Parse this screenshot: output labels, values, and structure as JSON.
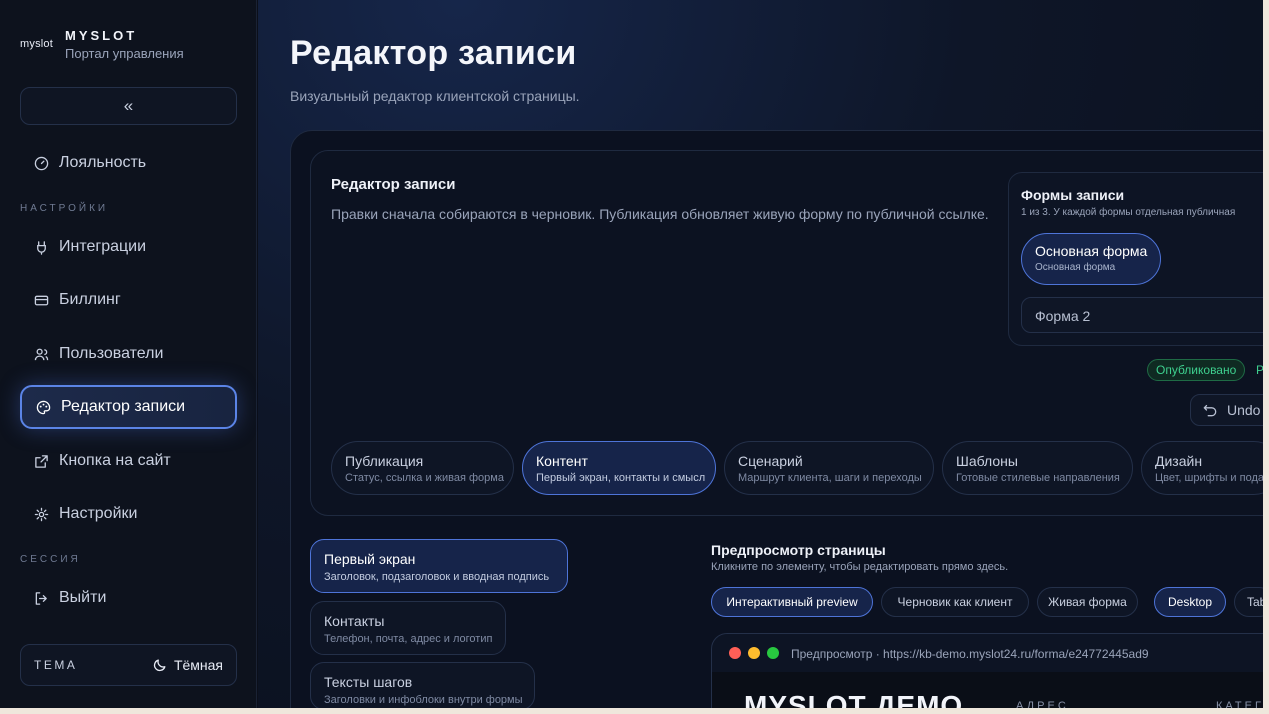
{
  "brand": {
    "logo": "myslot",
    "name": "MYSLOT",
    "subtitle": "Портал управления"
  },
  "sidebar": {
    "collapse_label": "«",
    "items": [
      {
        "label": "Лояльность",
        "icon": "gauge-icon"
      },
      {
        "label": "Интеграции",
        "icon": "plug-icon"
      },
      {
        "label": "Биллинг",
        "icon": "card-icon"
      },
      {
        "label": "Пользователи",
        "icon": "users-icon"
      },
      {
        "label": "Редактор записи",
        "icon": "palette-icon",
        "active": true
      },
      {
        "label": "Кнопка на сайт",
        "icon": "external-link-icon"
      },
      {
        "label": "Настройки",
        "icon": "gear-icon"
      },
      {
        "label": "Выйти",
        "icon": "logout-icon"
      }
    ],
    "section_settings": "НАСТРОЙКИ",
    "section_session": "СЕССИЯ",
    "theme_label": "ТЕМА",
    "theme_value": "Тёмная"
  },
  "page": {
    "title": "Редактор записи",
    "subtitle": "Визуальный редактор клиентской страницы."
  },
  "editor": {
    "title": "Редактор записи",
    "description": "Правки сначала собираются в черновик. Публикация обновляет живую форму по публичной ссылке.",
    "forms": {
      "title": "Формы записи",
      "subtitle": "1 из 3. У каждой формы отдельная публичная",
      "active_name": "Основная форма",
      "active_sub": "Основная форма",
      "second": "Форма 2"
    },
    "status": "Опубликовано",
    "status_extra": "Р",
    "undo_label": "Undo",
    "tabs": [
      {
        "title": "Публикация",
        "sub": "Статус, ссылка и живая форма"
      },
      {
        "title": "Контент",
        "sub": "Первый экран, контакты и смысл",
        "active": true
      },
      {
        "title": "Сценарий",
        "sub": "Маршрут клиента, шаги и переходы"
      },
      {
        "title": "Шаблоны",
        "sub": "Готовые стилевые направления"
      },
      {
        "title": "Дизайн",
        "sub": "Цвет, шрифты и подач"
      }
    ]
  },
  "sections": [
    {
      "title": "Первый экран",
      "sub": "Заголовок, подзаголовок и вводная подпись",
      "active": true
    },
    {
      "title": "Контакты",
      "sub": "Телефон, почта, адрес и логотип"
    },
    {
      "title": "Тексты шагов",
      "sub": "Заголовки и инфоблоки внутри формы"
    }
  ],
  "preview": {
    "title": "Предпросмотр страницы",
    "subtitle": "Кликните по элементу, чтобы редактировать прямо здесь.",
    "chips": [
      "Интерактивный preview",
      "Черновик как клиент",
      "Живая форма",
      "Desktop",
      "Tab"
    ],
    "url": "Предпросмотр · https://kb-demo.myslot24.ru/forma/e24772445ad9",
    "demo_title": "MYSLOT ДЕМО",
    "demo_addr": "АДРЕС",
    "demo_cat": "КАТЕГ"
  },
  "colors": {
    "accent": "#4e74d8",
    "success": "#3ecf8e",
    "bg": "#0b0f1a"
  }
}
